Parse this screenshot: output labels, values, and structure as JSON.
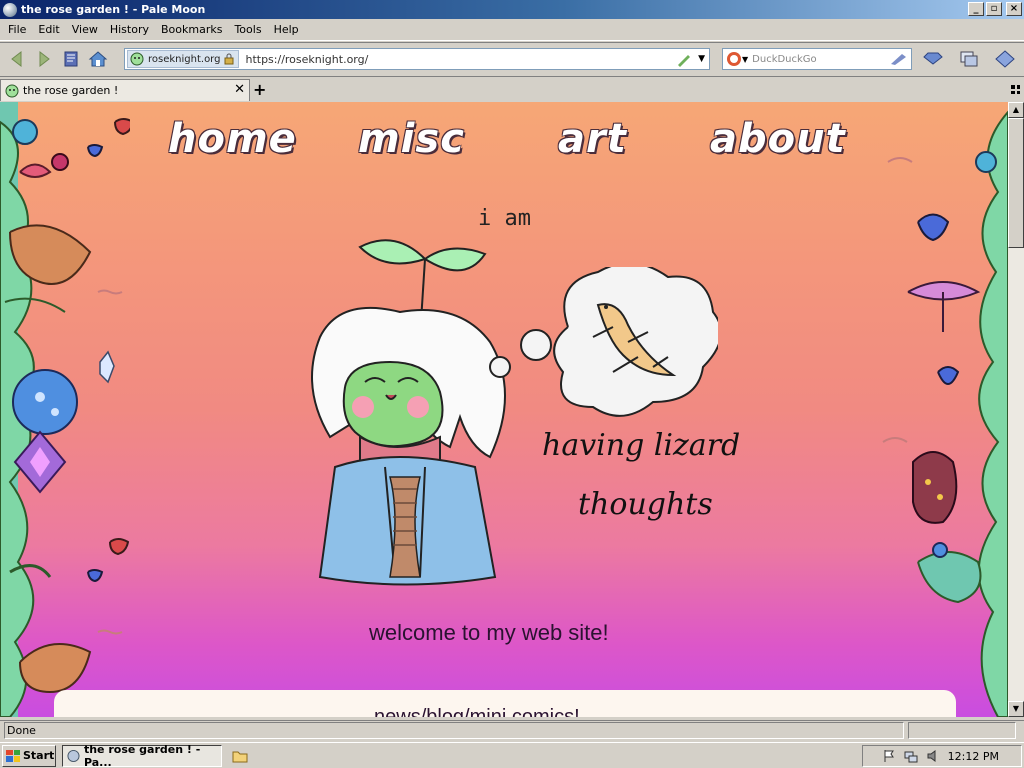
{
  "window": {
    "title": "the rose garden ! - Pale Moon"
  },
  "menu": [
    "File",
    "Edit",
    "View",
    "History",
    "Bookmarks",
    "Tools",
    "Help"
  ],
  "navbar": {
    "identity": "roseknight.org",
    "url": "https://roseknight.org/",
    "search_placeholder": "DuckDuckGo"
  },
  "tabs": [
    {
      "label": "the rose garden !"
    }
  ],
  "page": {
    "nav": [
      "home",
      "misc",
      "art",
      "about"
    ],
    "i_am": "i am",
    "having": "having lizard",
    "thoughts": "thoughts",
    "welcome": "welcome to my web site!",
    "content_heading": "news/blog/mini comics!"
  },
  "status": {
    "text": "Done"
  },
  "taskbar": {
    "start": "Start",
    "task": "the rose garden ! - Pa...",
    "clock": "12:12 PM"
  },
  "colors": {
    "title_gradient_start": "#0a246a",
    "bg_top": "#f6a776",
    "bg_bottom": "#c94de0"
  },
  "icons": [
    "back-icon",
    "forward-icon",
    "reload-icon",
    "home-icon",
    "lock-icon",
    "search-engine-icon",
    "downloads-icon",
    "windows-flag-icon"
  ]
}
